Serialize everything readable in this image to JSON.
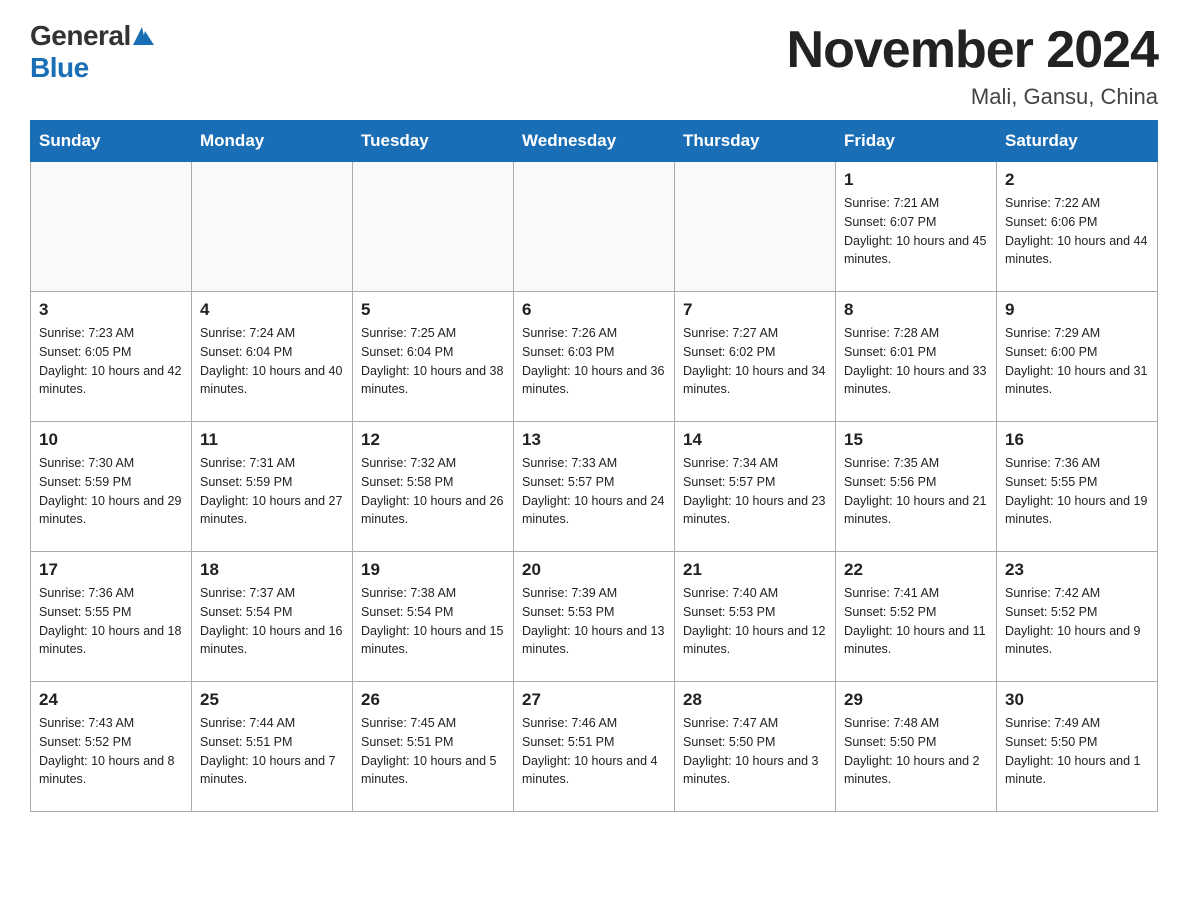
{
  "logo": {
    "general": "General",
    "blue": "Blue"
  },
  "header": {
    "title": "November 2024",
    "subtitle": "Mali, Gansu, China"
  },
  "weekdays": [
    "Sunday",
    "Monday",
    "Tuesday",
    "Wednesday",
    "Thursday",
    "Friday",
    "Saturday"
  ],
  "weeks": [
    [
      {
        "day": "",
        "info": ""
      },
      {
        "day": "",
        "info": ""
      },
      {
        "day": "",
        "info": ""
      },
      {
        "day": "",
        "info": ""
      },
      {
        "day": "",
        "info": ""
      },
      {
        "day": "1",
        "info": "Sunrise: 7:21 AM\nSunset: 6:07 PM\nDaylight: 10 hours and 45 minutes."
      },
      {
        "day": "2",
        "info": "Sunrise: 7:22 AM\nSunset: 6:06 PM\nDaylight: 10 hours and 44 minutes."
      }
    ],
    [
      {
        "day": "3",
        "info": "Sunrise: 7:23 AM\nSunset: 6:05 PM\nDaylight: 10 hours and 42 minutes."
      },
      {
        "day": "4",
        "info": "Sunrise: 7:24 AM\nSunset: 6:04 PM\nDaylight: 10 hours and 40 minutes."
      },
      {
        "day": "5",
        "info": "Sunrise: 7:25 AM\nSunset: 6:04 PM\nDaylight: 10 hours and 38 minutes."
      },
      {
        "day": "6",
        "info": "Sunrise: 7:26 AM\nSunset: 6:03 PM\nDaylight: 10 hours and 36 minutes."
      },
      {
        "day": "7",
        "info": "Sunrise: 7:27 AM\nSunset: 6:02 PM\nDaylight: 10 hours and 34 minutes."
      },
      {
        "day": "8",
        "info": "Sunrise: 7:28 AM\nSunset: 6:01 PM\nDaylight: 10 hours and 33 minutes."
      },
      {
        "day": "9",
        "info": "Sunrise: 7:29 AM\nSunset: 6:00 PM\nDaylight: 10 hours and 31 minutes."
      }
    ],
    [
      {
        "day": "10",
        "info": "Sunrise: 7:30 AM\nSunset: 5:59 PM\nDaylight: 10 hours and 29 minutes."
      },
      {
        "day": "11",
        "info": "Sunrise: 7:31 AM\nSunset: 5:59 PM\nDaylight: 10 hours and 27 minutes."
      },
      {
        "day": "12",
        "info": "Sunrise: 7:32 AM\nSunset: 5:58 PM\nDaylight: 10 hours and 26 minutes."
      },
      {
        "day": "13",
        "info": "Sunrise: 7:33 AM\nSunset: 5:57 PM\nDaylight: 10 hours and 24 minutes."
      },
      {
        "day": "14",
        "info": "Sunrise: 7:34 AM\nSunset: 5:57 PM\nDaylight: 10 hours and 23 minutes."
      },
      {
        "day": "15",
        "info": "Sunrise: 7:35 AM\nSunset: 5:56 PM\nDaylight: 10 hours and 21 minutes."
      },
      {
        "day": "16",
        "info": "Sunrise: 7:36 AM\nSunset: 5:55 PM\nDaylight: 10 hours and 19 minutes."
      }
    ],
    [
      {
        "day": "17",
        "info": "Sunrise: 7:36 AM\nSunset: 5:55 PM\nDaylight: 10 hours and 18 minutes."
      },
      {
        "day": "18",
        "info": "Sunrise: 7:37 AM\nSunset: 5:54 PM\nDaylight: 10 hours and 16 minutes."
      },
      {
        "day": "19",
        "info": "Sunrise: 7:38 AM\nSunset: 5:54 PM\nDaylight: 10 hours and 15 minutes."
      },
      {
        "day": "20",
        "info": "Sunrise: 7:39 AM\nSunset: 5:53 PM\nDaylight: 10 hours and 13 minutes."
      },
      {
        "day": "21",
        "info": "Sunrise: 7:40 AM\nSunset: 5:53 PM\nDaylight: 10 hours and 12 minutes."
      },
      {
        "day": "22",
        "info": "Sunrise: 7:41 AM\nSunset: 5:52 PM\nDaylight: 10 hours and 11 minutes."
      },
      {
        "day": "23",
        "info": "Sunrise: 7:42 AM\nSunset: 5:52 PM\nDaylight: 10 hours and 9 minutes."
      }
    ],
    [
      {
        "day": "24",
        "info": "Sunrise: 7:43 AM\nSunset: 5:52 PM\nDaylight: 10 hours and 8 minutes."
      },
      {
        "day": "25",
        "info": "Sunrise: 7:44 AM\nSunset: 5:51 PM\nDaylight: 10 hours and 7 minutes."
      },
      {
        "day": "26",
        "info": "Sunrise: 7:45 AM\nSunset: 5:51 PM\nDaylight: 10 hours and 5 minutes."
      },
      {
        "day": "27",
        "info": "Sunrise: 7:46 AM\nSunset: 5:51 PM\nDaylight: 10 hours and 4 minutes."
      },
      {
        "day": "28",
        "info": "Sunrise: 7:47 AM\nSunset: 5:50 PM\nDaylight: 10 hours and 3 minutes."
      },
      {
        "day": "29",
        "info": "Sunrise: 7:48 AM\nSunset: 5:50 PM\nDaylight: 10 hours and 2 minutes."
      },
      {
        "day": "30",
        "info": "Sunrise: 7:49 AM\nSunset: 5:50 PM\nDaylight: 10 hours and 1 minute."
      }
    ]
  ]
}
